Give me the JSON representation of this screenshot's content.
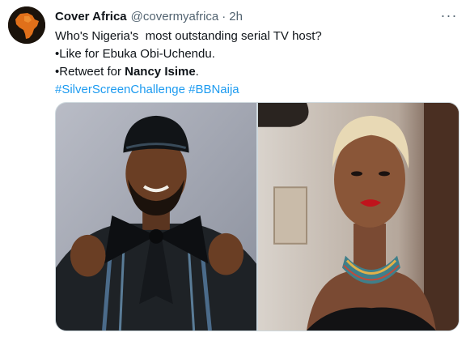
{
  "tweet": {
    "author_name": "Cover Africa",
    "handle": "@covermyafrica",
    "separator": "·",
    "time": "2h",
    "more_icon": "more-horizontal-icon",
    "lines": {
      "l1": "Who's Nigeria's  most outstanding serial TV host?",
      "l2": "•Like for Ebuka Obi-Uchendu.",
      "l3_prefix": "•Retweet for ",
      "l3_bold": "Nancy Isime",
      "l3_suffix": "."
    },
    "hashtags": [
      "#SilverScreenChallenge",
      "#BBNaija"
    ]
  },
  "media": {
    "photo_left": "man-in-black-agbada-with-bow-photo",
    "photo_right": "woman-with-blonde-short-hair-beaded-necklace-photo"
  },
  "colors": {
    "link": "#1d9bf0",
    "text": "#0f1419",
    "secondary": "#536471"
  }
}
